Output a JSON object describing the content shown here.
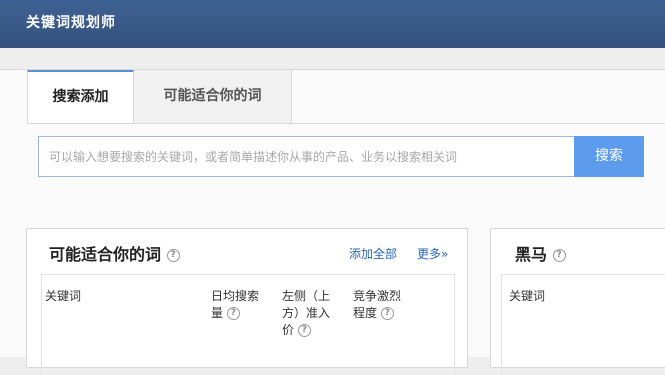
{
  "window": {
    "title": "关键词规划师"
  },
  "tabs": [
    {
      "label": "搜索添加"
    },
    {
      "label": "可能适合你的词"
    }
  ],
  "search": {
    "placeholder": "可以输入想要搜索的关键词，或者简单描述你从事的产品、业务以搜索相关词",
    "button_label": "搜索"
  },
  "suggest_card": {
    "title": "可能适合你的词",
    "add_all_label": "添加全部",
    "more_label": "更多»",
    "columns": [
      {
        "line1": "关键词",
        "line2": "",
        "line3": ""
      },
      {
        "line1": "日均搜索",
        "line2": "量",
        "line3": ""
      },
      {
        "line1": "左侧（上",
        "line2": "方）准入",
        "line3": "价"
      },
      {
        "line1": "竞争激烈",
        "line2": "程度",
        "line3": ""
      }
    ]
  },
  "dark_horse_card": {
    "title": "黑马",
    "columns": [
      {
        "line1": "关键词"
      }
    ]
  },
  "icons": {
    "help": "?"
  }
}
